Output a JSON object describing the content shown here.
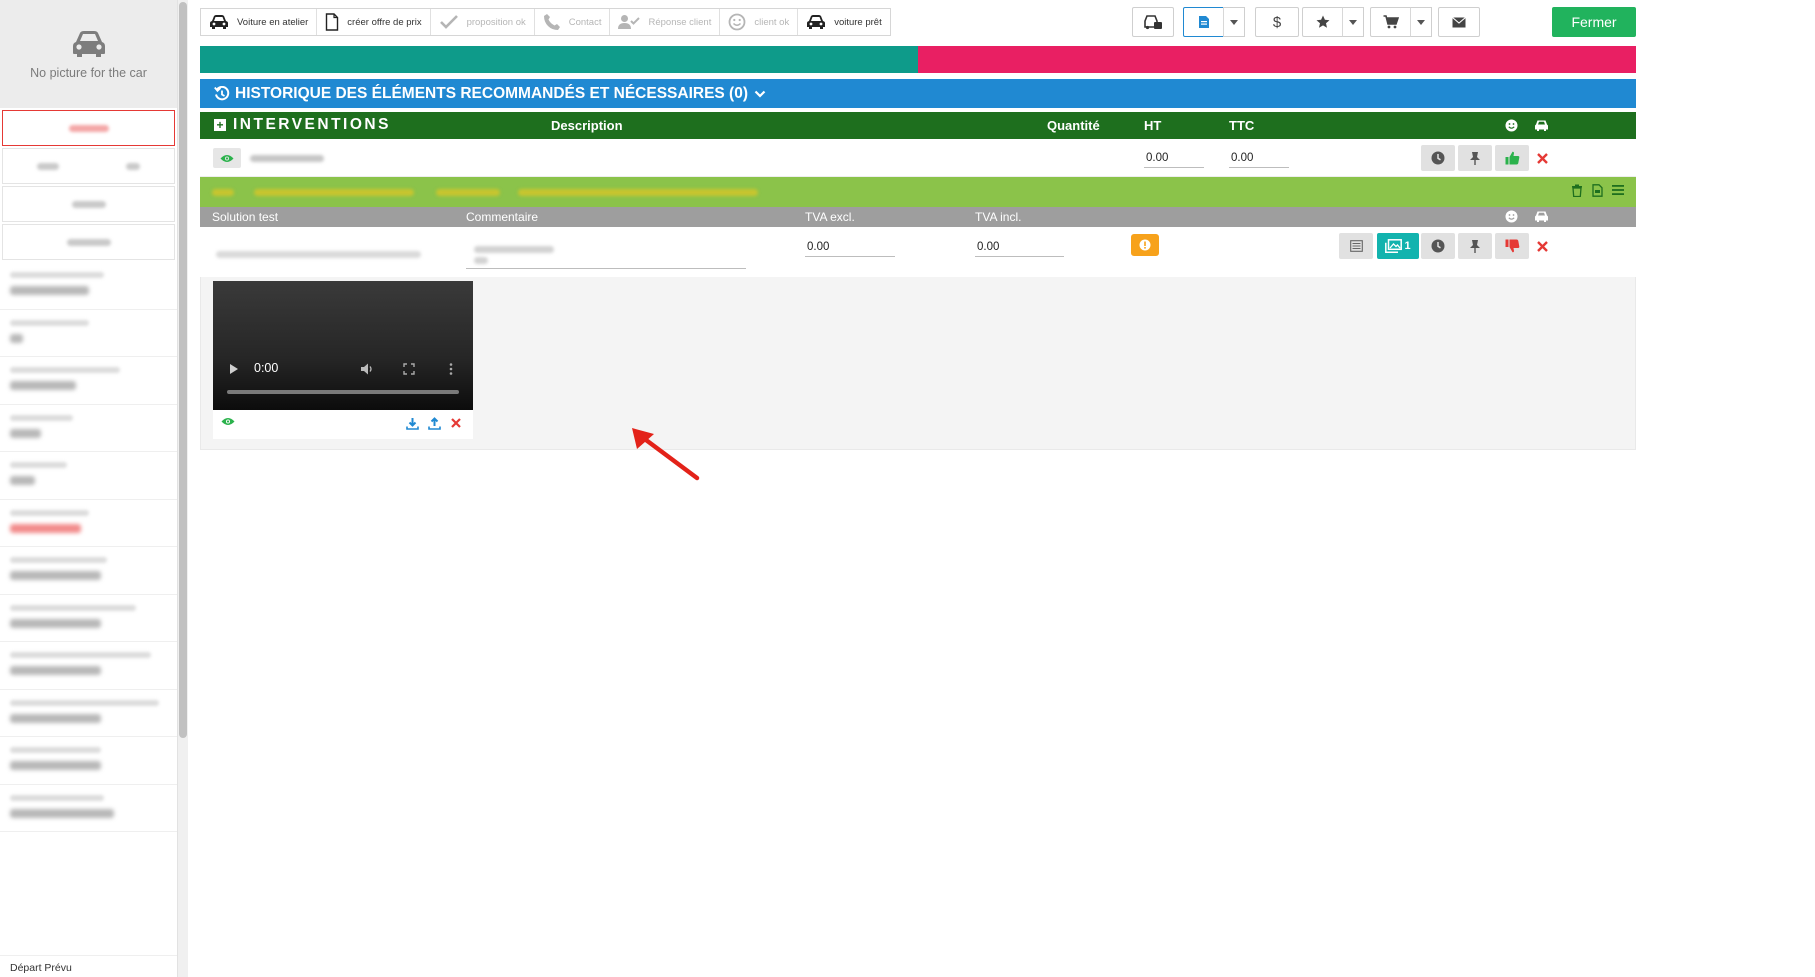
{
  "sidebar": {
    "no_picture_text": "No picture for the car",
    "bottom_label": "Départ Prévu"
  },
  "steps": [
    {
      "label": "Voiture en atelier",
      "icon": "car-icon",
      "state": "active"
    },
    {
      "label": "créer offre de prix",
      "icon": "document-icon",
      "state": "active"
    },
    {
      "label": "proposition ok",
      "icon": "check-icon",
      "state": "muted"
    },
    {
      "label": "Contact",
      "icon": "phone-icon",
      "state": "muted"
    },
    {
      "label": "Réponse client",
      "icon": "user-check-icon",
      "state": "muted"
    },
    {
      "label": "client ok",
      "icon": "smile-icon",
      "state": "muted"
    },
    {
      "label": "voiture prêt",
      "icon": "car-icon",
      "state": "active"
    }
  ],
  "toolbar": {
    "close_label": "Fermer",
    "dollar_label": "$"
  },
  "progress": {
    "segments": [
      {
        "color": "#0e9b8a",
        "fraction": 0.5
      },
      {
        "color": "#e91f63",
        "fraction": 0.5
      }
    ]
  },
  "historique": {
    "label": "HISTORIQUE DES ÉLÉMENTS RECOMMANDÉS ET NÉCESSAIRES (0)"
  },
  "interventions": {
    "title": "INTERVENTIONS",
    "col_description": "Description",
    "col_quantite": "Quantité",
    "col_ht": "HT",
    "col_ttc": "TTC",
    "row": {
      "ht": "0.00",
      "ttc": "0.00"
    }
  },
  "solution": {
    "col_solution": "Solution test",
    "col_commentaire": "Commentaire",
    "col_tva_excl": "TVA excl.",
    "col_tva_incl": "TVA incl.",
    "row": {
      "tva_excl": "0.00",
      "tva_incl": "0.00",
      "media_count": "1"
    }
  },
  "video": {
    "time": "0:00"
  },
  "colors": {
    "accent_blue": "#2089d2",
    "interventions_green": "#1e6f1e",
    "solution_green": "#8bc34a",
    "close_button": "#21b35d",
    "teal": "#0e9b8a",
    "pink": "#e91f63"
  }
}
